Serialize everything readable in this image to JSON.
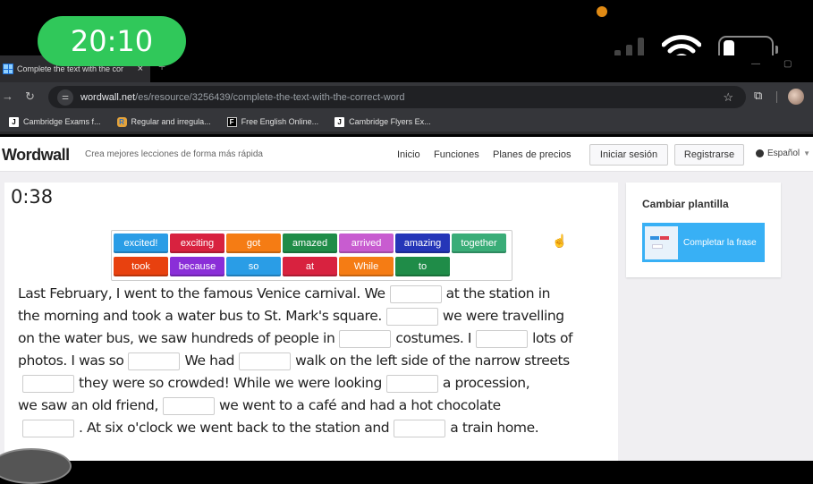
{
  "device": {
    "time": "20:10",
    "signal_bars_on": 1,
    "signal_bars_total": 4
  },
  "browser": {
    "tab_title": "Complete the text with the cor",
    "tab_close": "×",
    "new_tab": "+",
    "url_host": "wordwall.net",
    "url_path": "/es/resource/3256439/complete-the-text-with-the-correct-word",
    "bookmarks": [
      {
        "icon": "J",
        "label": "Cambridge Exams f..."
      },
      {
        "icon": "R",
        "label": "Regular and irregula..."
      },
      {
        "icon": "F",
        "label": "Free English Online..."
      },
      {
        "icon": "J",
        "label": "Cambridge Flyers Ex..."
      }
    ]
  },
  "header": {
    "logo": "Wordwall",
    "tagline": "Crea mejores lecciones de forma más rápida",
    "nav": [
      "Inicio",
      "Funciones",
      "Planes de precios"
    ],
    "login": "Iniciar sesión",
    "register": "Registrarse",
    "language": "Español"
  },
  "activity": {
    "timer": "0:38",
    "word_bank": [
      {
        "word": "excited!",
        "color": "#2a9de6"
      },
      {
        "word": "exciting",
        "color": "#d8223f"
      },
      {
        "word": "got",
        "color": "#f57c14"
      },
      {
        "word": "amazed",
        "color": "#1f8c48"
      },
      {
        "word": "arrived",
        "color": "#c85cd0"
      },
      {
        "word": "amazing",
        "color": "#2536b8"
      },
      {
        "word": "together",
        "color": "#3aad78"
      },
      {
        "word": "took",
        "color": "#e8410f"
      },
      {
        "word": "because",
        "color": "#8a2ed8"
      },
      {
        "word": "so",
        "color": "#2a9de6"
      },
      {
        "word": "at",
        "color": "#d8223f"
      },
      {
        "word": "While",
        "color": "#f57c14"
      },
      {
        "word": "to",
        "color": "#1f8c48"
      }
    ],
    "passage_lines": [
      [
        "Last February, I went to the famous Venice carnival. We",
        "BLANK",
        "at the station in"
      ],
      [
        "the morning and took a water bus to St. Mark's square.",
        "BLANK",
        "we were travelling"
      ],
      [
        "on the water bus, we saw hundreds of people in",
        "BLANK",
        "costumes. I",
        "BLANK",
        "lots of"
      ],
      [
        "photos. I was so",
        "BLANK",
        "We had",
        "BLANK",
        "walk on the left side of the narrow streets"
      ],
      [
        "",
        "BLANK",
        "they were so crowded! While we were looking",
        "BLANK",
        "a procession,"
      ],
      [
        "we saw an old friend,",
        "BLANK",
        "we went to a café and had a hot chocolate"
      ],
      [
        "",
        "BLANK",
        ". At six o'clock we went back to the station and",
        "BLANK",
        "a train home."
      ]
    ]
  },
  "sidebar": {
    "title": "Cambiar plantilla",
    "template_label": "Completar la frase"
  }
}
